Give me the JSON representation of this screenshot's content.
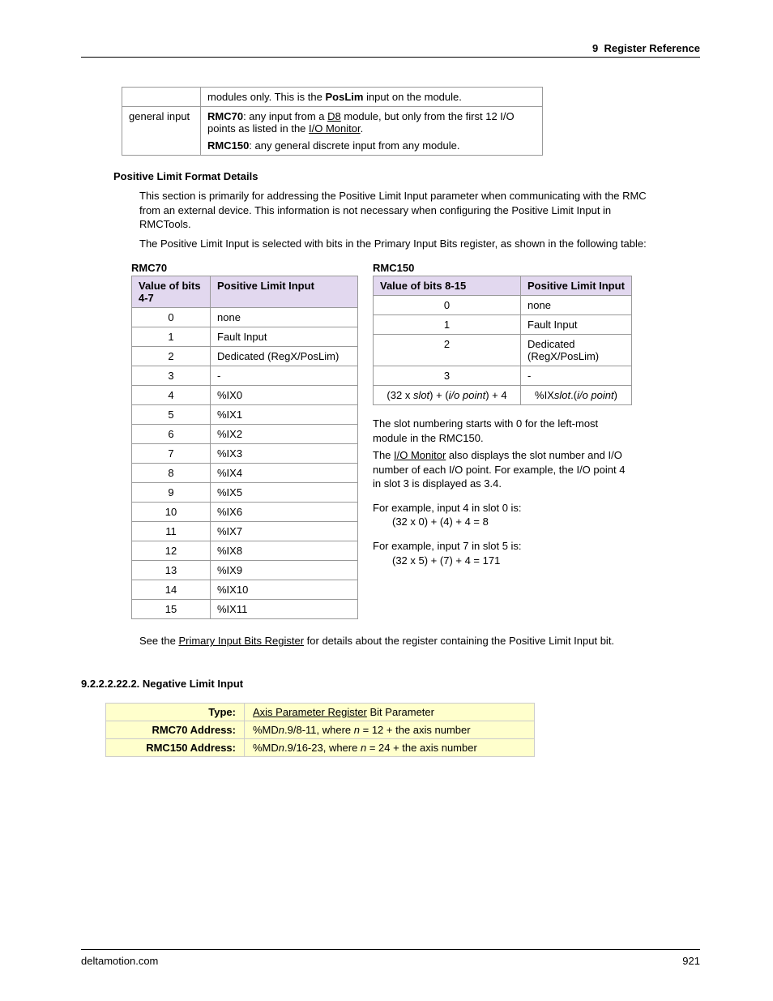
{
  "header": {
    "chapter": "9",
    "title": "Register Reference"
  },
  "footer": {
    "site": "deltamotion.com",
    "page": "921"
  },
  "links": {
    "d8": "D8",
    "io_monitor": "I/O Monitor",
    "primary_input_bits": "Primary Input Bits Register",
    "axis_param_reg": "Axis Parameter Register"
  },
  "top_table": {
    "row1": {
      "col1": "",
      "col2_pre": "modules only. This is the ",
      "col2_bold": "PosLim",
      "col2_post": " input on the module."
    },
    "row2": {
      "col1": "general input",
      "rmc70_b": "RMC70",
      "rmc70_t1": ": any input from a ",
      "rmc70_t2": " module, but only from the first 12 I/O points as listed in the ",
      "rmc70_t3": ".",
      "rmc150_b": "RMC150",
      "rmc150_t": ": any general discrete input from any module."
    }
  },
  "pos_limit_heading": "Positive Limit Format Details",
  "para1": "This section is primarily for addressing the Positive Limit Input parameter when communicating with the RMC from an external device. This information is not necessary when configuring the Positive Limit Input in RMCTools.",
  "para2": "The Positive Limit Input is selected with bits in the Primary Input Bits register, as shown in the following table:",
  "rmc70": {
    "label": "RMC70",
    "h1": "Value of bits 4-7",
    "h2": "Positive Limit Input",
    "rows": [
      {
        "v": "0",
        "t": "none"
      },
      {
        "v": "1",
        "t": "Fault Input"
      },
      {
        "v": "2",
        "t": "Dedicated (RegX/PosLim)"
      },
      {
        "v": "3",
        "t": "-"
      },
      {
        "v": "4",
        "t": "%IX0"
      },
      {
        "v": "5",
        "t": "%IX1"
      },
      {
        "v": "6",
        "t": "%IX2"
      },
      {
        "v": "7",
        "t": "%IX3"
      },
      {
        "v": "8",
        "t": "%IX4"
      },
      {
        "v": "9",
        "t": "%IX5"
      },
      {
        "v": "10",
        "t": "%IX6"
      },
      {
        "v": "11",
        "t": "%IX7"
      },
      {
        "v": "12",
        "t": "%IX8"
      },
      {
        "v": "13",
        "t": "%IX9"
      },
      {
        "v": "14",
        "t": "%IX10"
      },
      {
        "v": "15",
        "t": "%IX11"
      }
    ]
  },
  "rmc150": {
    "label": "RMC150",
    "h1": "Value of bits 8-15",
    "h2": "Positive Limit Input",
    "rows": [
      {
        "v": "0",
        "t": "none"
      },
      {
        "v": "1",
        "t": "Fault Input"
      },
      {
        "v": "2",
        "t": "Dedicated (RegX/PosLim)"
      },
      {
        "v": "3",
        "t": "-"
      }
    ],
    "formula_row": {
      "c1a": "(32 x ",
      "c1b": "slot",
      "c1c": ") + (",
      "c1d": "i/o point",
      "c1e": ") + 4",
      "c2a": "%IX",
      "c2b": "slot",
      "c2c": ".(",
      "c2d": "i/o point",
      "c2e": ")"
    },
    "note1a": "The slot numbering starts with 0 for the left-most module in the RMC150.",
    "note2a": "The ",
    "note2b": " also displays the slot number and I/O number of each I/O point. For example, the I/O point 4 in slot 3 is displayed as 3.4.",
    "ex1a": "For example, input 4 in slot 0 is:",
    "ex1b": "(32 x 0) + (4) + 4 = 8",
    "ex2a": "For example, input 7 in slot 5 is:",
    "ex2b": "(32 x 5) + (7) + 4 = 171"
  },
  "para3a": "See the ",
  "para3b": " for details about the register containing the Positive Limit Input bit.",
  "section": "9.2.2.2.22.2. Negative Limit Input",
  "yellow": {
    "r1l": "Type:",
    "r1v_post": " Bit Parameter",
    "r2l": "RMC70 Address:",
    "r2a": "%MD",
    "r2b": "n",
    "r2c": ".9/8-11, where ",
    "r2d": "n",
    "r2e": " = 12 + the axis number",
    "r3l": "RMC150 Address:",
    "r3a": "%MD",
    "r3b": "n",
    "r3c": ".9/16-23, where ",
    "r3d": "n",
    "r3e": " = 24 + the axis number"
  }
}
